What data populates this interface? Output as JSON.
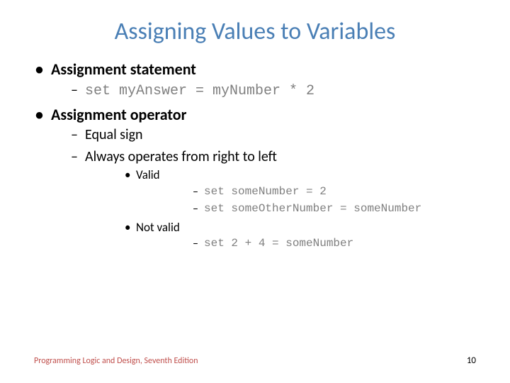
{
  "title": "Assigning Values to Variables",
  "bullets": {
    "b1": "Assignment statement",
    "b1_1": "set myAnswer = myNumber * 2",
    "b2": "Assignment operator",
    "b2_1": "Equal sign",
    "b2_2": "Always operates from right to left",
    "b2_2_1": "Valid",
    "b2_2_1_1": "set someNumber = 2",
    "b2_2_1_2": "set someOtherNumber = someNumber",
    "b2_2_2": "Not valid",
    "b2_2_2_1": "set 2 + 4 = someNumber"
  },
  "footer": {
    "left": "Programming Logic and Design, Seventh Edition",
    "page": "10"
  }
}
